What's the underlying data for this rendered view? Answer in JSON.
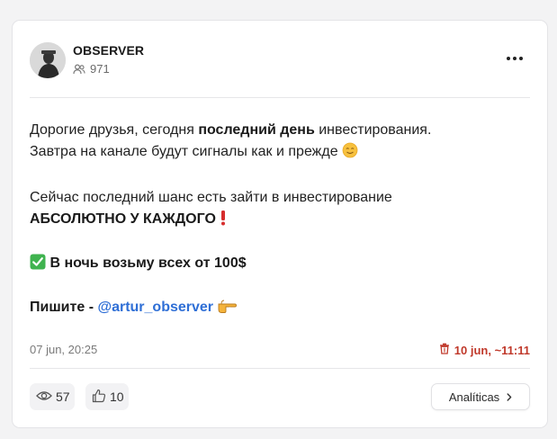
{
  "channel": {
    "name": "OBSERVER",
    "subscribers": "971"
  },
  "post": {
    "line1_pre": "Дорогие друзья, сегодня ",
    "line1_bold": "последний день",
    "line1_post": " инвестирования.",
    "line2": "Завтра на канале будут сигналы как и прежде",
    "line3": "Сейчас последний шанс есть зайти в инвестирование",
    "line4": "АБСОЛЮТНО У КАЖДОГО",
    "line5": "В ночь возьму всех от 100$",
    "line6_label": "Пишите - ",
    "line6_link": "@artur_observer"
  },
  "meta": {
    "date": "07 jun, 20:25",
    "expires": "10 jun, ~11:11"
  },
  "stats": {
    "views": "57",
    "likes": "10"
  },
  "actions": {
    "analytics_label": "Analíticas"
  },
  "icons": {
    "avatar": "avatar-image",
    "subscribers": "users-icon",
    "more": "more-dots-icon",
    "emoji1": "smile-emoji-icon",
    "emoji2": "exclamation-emoji-icon",
    "emoji3": "check-mark-emoji-icon",
    "emoji4": "pointing-hand-emoji-icon",
    "expire": "trash-icon",
    "views": "eye-icon",
    "likes": "thumbs-up-icon",
    "analytics": "chevron-right-icon"
  },
  "colors": {
    "link": "#2f6fd6",
    "expire": "#c0392b",
    "check": "#3fb34f"
  }
}
